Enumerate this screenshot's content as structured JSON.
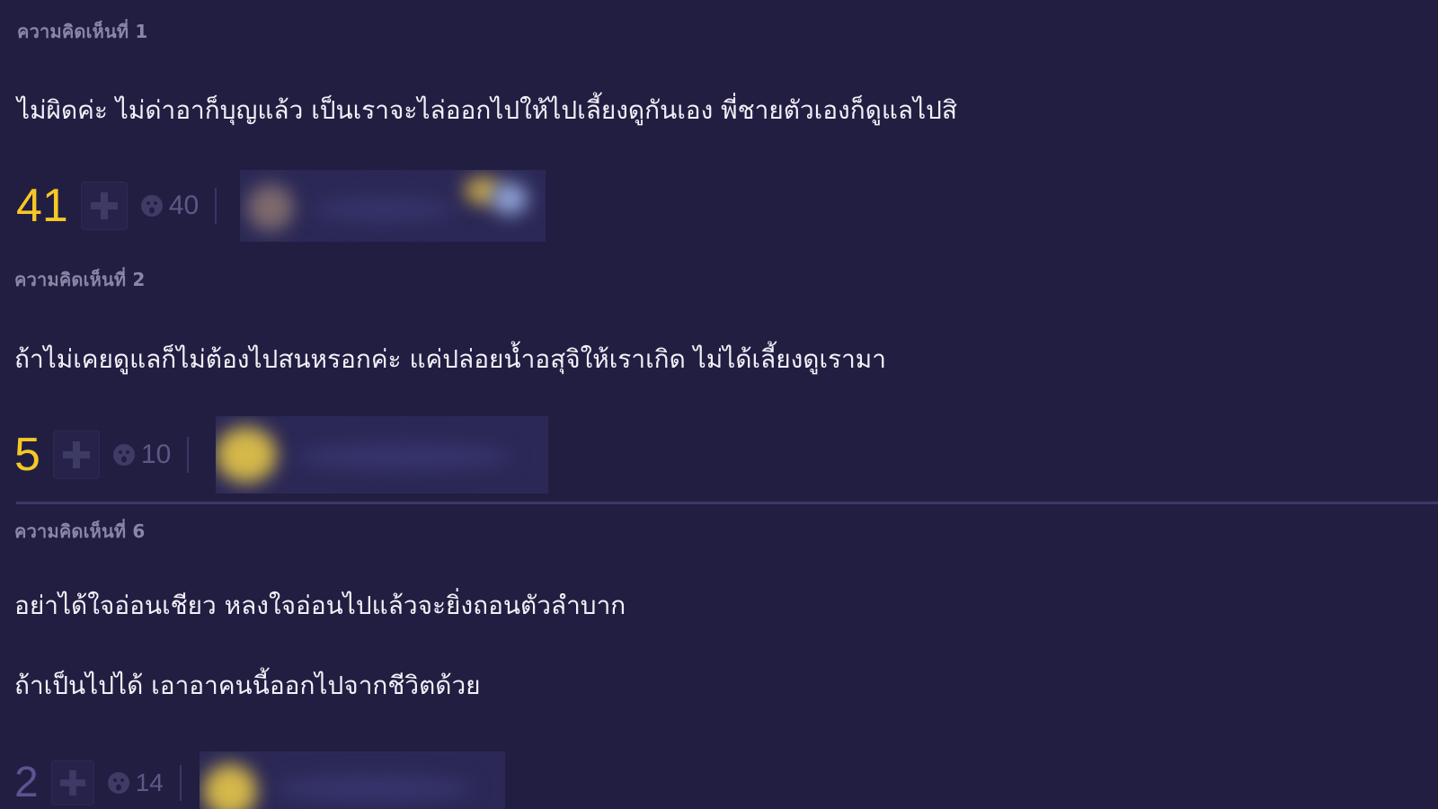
{
  "comments": [
    {
      "header": "ความคิดเห็นที่ 1",
      "lines": [
        "ไม่ผิดค่ะ ไม่ด่าอาก็บุญแล้ว เป็นเราจะไล่ออกไปให้ไปเลี้ยงดูกันเอง พี่ชายตัวเองก็ดูแลไปสิ"
      ],
      "score": "41",
      "emotion_count": "40"
    },
    {
      "header": "ความคิดเห็นที่ 2",
      "lines": [
        "ถ้าไม่เคยดูแลก็ไม่ต้องไปสนหรอกค่ะ แค่ปล่อยน้ำอสุจิให้เราเกิด ไม่ได้เลี้ยงดูเรามา"
      ],
      "score": "5",
      "emotion_count": "10"
    },
    {
      "header": "ความคิดเห็นที่ 6",
      "lines": [
        "อย่าได้ใจอ่อนเชียว  หลงใจอ่อนไปแล้วจะยิ่งถอนตัวลำบาก",
        "ถ้าเป็นไปได้  เอาอาคนนี้ออกไปจากชีวิตด้วย"
      ],
      "score": "2",
      "emotion_count": "14"
    }
  ],
  "icons": {
    "vote": "plus-icon",
    "emotion": "emotion-face-icon"
  },
  "colors": {
    "background": "#221e42",
    "score": "#f5c826",
    "header": "#8a86a6",
    "text": "#f2f0f7"
  }
}
